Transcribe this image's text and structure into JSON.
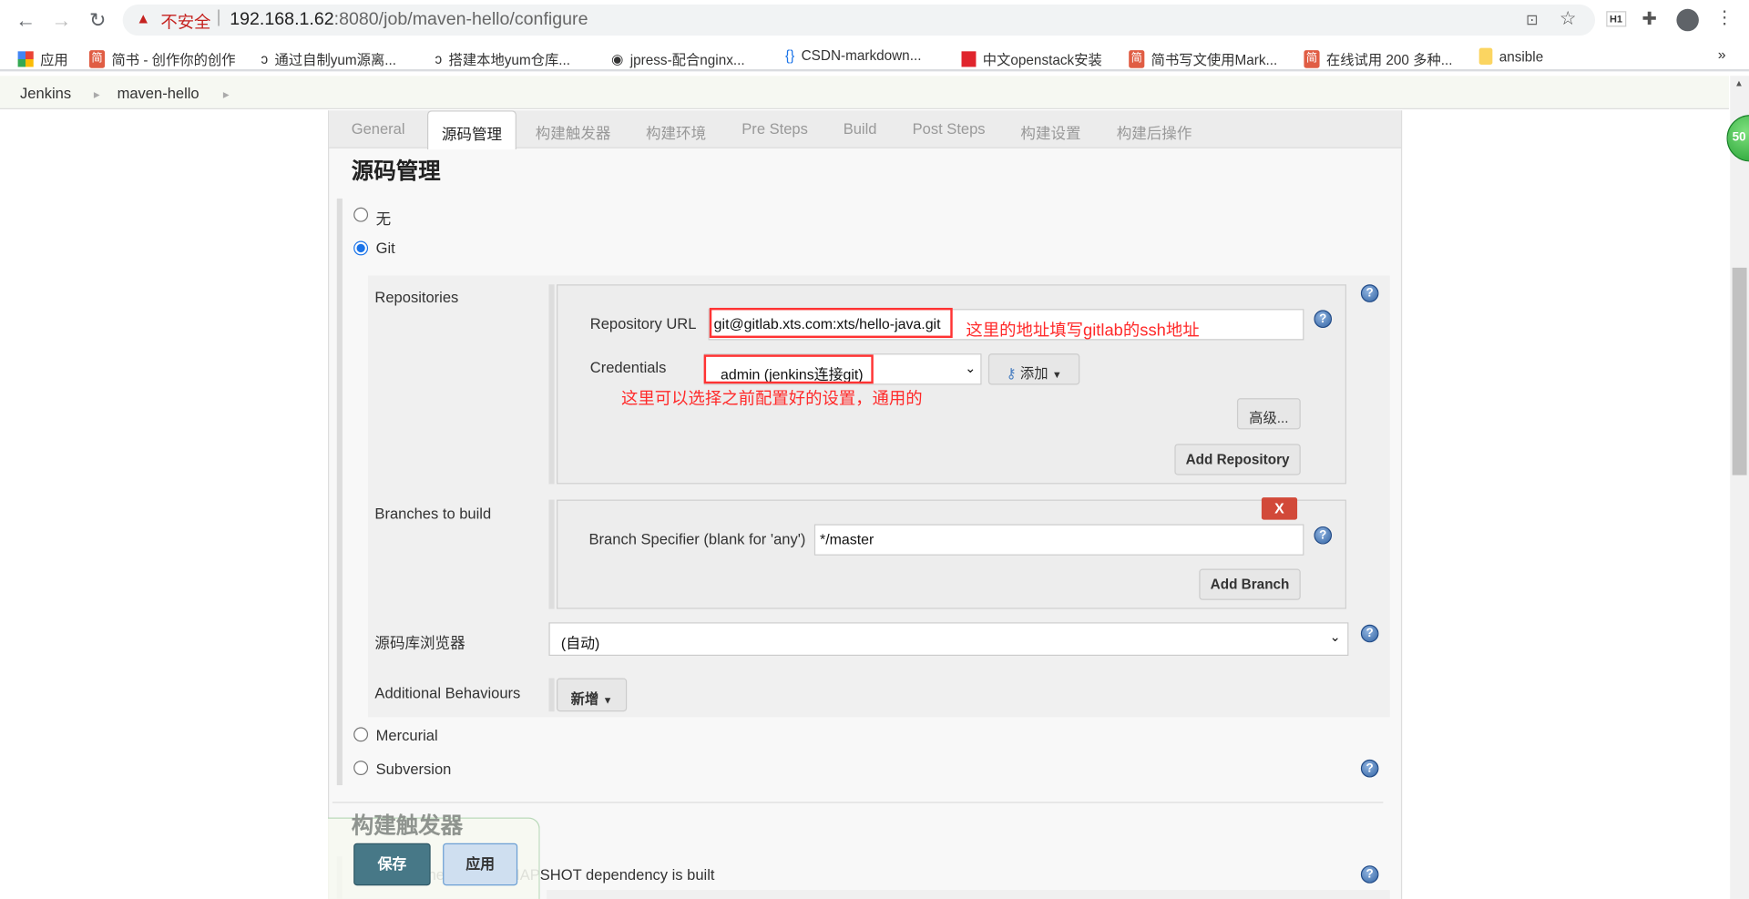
{
  "browser": {
    "insecure_label": "不安全",
    "url_host": "192.168.1.62",
    "url_rest": ":8080/job/maven-hello/configure",
    "bookmarks": [
      "应用",
      "简书 - 创作你的创作",
      "通过自制yum源离...",
      "搭建本地yum仓库...",
      "jpress-配合nginx...",
      "CSDN-markdown...",
      "中文openstack安装",
      "简书写文使用Mark...",
      "在线试用 200 多种...",
      "ansible"
    ],
    "more": "»",
    "ext_label": "H1"
  },
  "breadcrumb": [
    "Jenkins",
    "maven-hello"
  ],
  "tabs": [
    "General",
    "源码管理",
    "构建触发器",
    "构建环境",
    "Pre Steps",
    "Build",
    "Post Steps",
    "构建设置",
    "构建后操作"
  ],
  "scm": {
    "title": "源码管理",
    "options": {
      "none": "无",
      "git": "Git",
      "mercurial": "Mercurial",
      "subversion": "Subversion"
    },
    "selected": "Git",
    "repositories_label": "Repositories",
    "repo_url_label": "Repository URL",
    "repo_url": "git@gitlab.xts.com:xts/hello-java.git",
    "credentials_label": "Credentials",
    "credentials": "admin (jenkins连接git)",
    "add_label": "添加",
    "advanced_label": "高级...",
    "add_repository_label": "Add Repository",
    "branches_label": "Branches to build",
    "delete_label": "X",
    "branch_spec_label": "Branch Specifier (blank for 'any')",
    "branch_spec": "*/master",
    "add_branch_label": "Add Branch",
    "browser_label": "源码库浏览器",
    "browser_value": "(自动)",
    "behaviours_label": "Additional Behaviours",
    "new_label": "新增"
  },
  "annotations": {
    "url_note": "这里的地址填写gitlab的ssh地址",
    "cred_note": "这里可以选择之前配置好的设置，通用的"
  },
  "triggers": {
    "title": "构建触发器",
    "snapshot": "Build whenever a SNAPSHOT dependency is built"
  },
  "footer": {
    "save": "保存",
    "apply": "应用"
  },
  "badge": "50"
}
